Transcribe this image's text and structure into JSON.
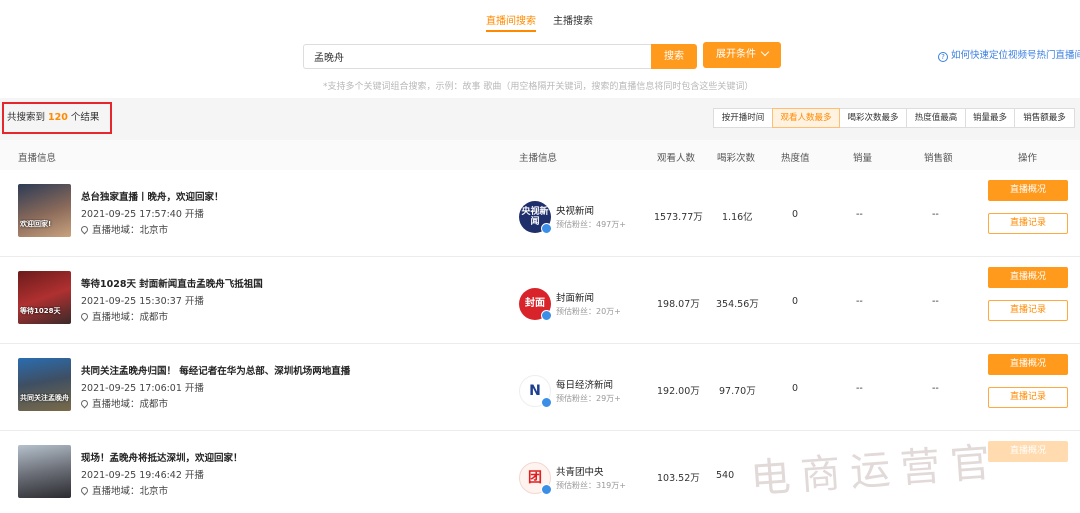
{
  "tabs": {
    "live_search": "直播间搜索",
    "anchor_search": "主播搜索"
  },
  "search": {
    "value": "孟晚舟",
    "button": "搜索",
    "expand": "展开条件",
    "help": "如何快速定位视频号热门直播间",
    "hint": "*支持多个关键词组合搜索，示例：故事 歌曲（用空格隔开关键词，搜索的直播信息将同时包含这些关键词）"
  },
  "results": {
    "prefix": "共搜索到",
    "count": "120",
    "suffix": "个结果"
  },
  "sort": [
    "按开播时间",
    "观看人数最多",
    "喝彩次数最多",
    "热度值最高",
    "销量最多",
    "销售额最多"
  ],
  "sort_active": "观看人数最多",
  "columns": {
    "info": "直播信息",
    "anchor": "主播信息",
    "viewers": "观看人数",
    "cheers": "喝彩次数",
    "heat": "热度值",
    "sales": "销量",
    "revenue": "销售额",
    "action": "操作"
  },
  "actions": {
    "overview": "直播概况",
    "record": "直播记录"
  },
  "location_prefix": "直播地域：",
  "rows": [
    {
      "title": "总台独家直播丨晚舟，欢迎回家！",
      "time": "2021-09-25 17:57:40 开播",
      "location": "北京市",
      "anchor": "央视新闻",
      "avatar_text": "央视新闻",
      "fans": "预估粉丝：497万+",
      "viewers": "1573.77万",
      "cheers": "1.16亿",
      "heat": "0",
      "sales": "--",
      "revenue": "--",
      "thumb_caption": "欢迎回家!"
    },
    {
      "title": "等待1028天 封面新闻直击孟晚舟飞抵祖国",
      "time": "2021-09-25 15:30:37 开播",
      "location": "成都市",
      "anchor": "封面新闻",
      "avatar_text": "封面",
      "fans": "预估粉丝：20万+",
      "viewers": "198.07万",
      "cheers": "354.56万",
      "heat": "0",
      "sales": "--",
      "revenue": "--",
      "thumb_caption": "等待1028天"
    },
    {
      "title": "共同关注孟晚舟归国！ 每经记者在华为总部、深圳机场两地直播",
      "time": "2021-09-25 17:06:01 开播",
      "location": "成都市",
      "anchor": "每日经济新闻",
      "avatar_text": "N",
      "fans": "预估粉丝：29万+",
      "viewers": "192.00万",
      "cheers": "97.70万",
      "heat": "0",
      "sales": "--",
      "revenue": "--",
      "thumb_caption": "共同关注孟晚舟"
    },
    {
      "title": "现场！孟晚舟将抵达深圳，欢迎回家！",
      "time": "2021-09-25 19:46:42 开播",
      "location": "北京市",
      "anchor": "共青团中央",
      "avatar_text": "团",
      "fans": "预估粉丝：319万+",
      "viewers": "103.52万",
      "cheers": "540",
      "heat": "",
      "sales": "",
      "revenue": "",
      "thumb_caption": ""
    }
  ],
  "watermark": "电商运营官",
  "colors": {
    "accent": "#ff9a1c",
    "highlight_border": "#e5262d",
    "link": "#3a7ee0"
  }
}
